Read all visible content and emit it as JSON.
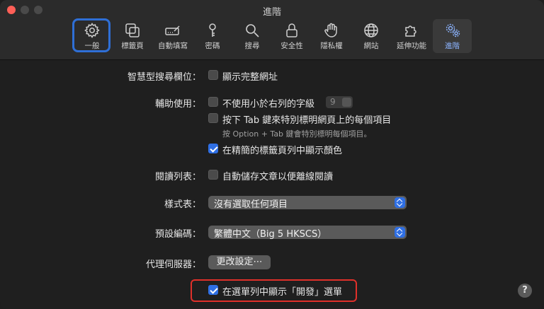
{
  "window": {
    "title": "進階"
  },
  "toolbar": {
    "items": [
      {
        "id": "general",
        "label": "一般",
        "icon": "gear-icon"
      },
      {
        "id": "tabs",
        "label": "標籤頁",
        "icon": "tabs-icon"
      },
      {
        "id": "autofill",
        "label": "自動填寫",
        "icon": "pencil-field-icon"
      },
      {
        "id": "passwords",
        "label": "密碼",
        "icon": "key-icon"
      },
      {
        "id": "search",
        "label": "搜尋",
        "icon": "search-icon"
      },
      {
        "id": "security",
        "label": "安全性",
        "icon": "lock-icon"
      },
      {
        "id": "privacy",
        "label": "隱私權",
        "icon": "hand-icon"
      },
      {
        "id": "websites",
        "label": "網站",
        "icon": "globe-icon"
      },
      {
        "id": "extensions",
        "label": "延伸功能",
        "icon": "puzzle-icon"
      },
      {
        "id": "advanced",
        "label": "進階",
        "icon": "gears-icon"
      }
    ]
  },
  "smart_search": {
    "label": "智慧型搜尋欄位：",
    "show_full_address": {
      "text": "顯示完整網址",
      "checked": false
    }
  },
  "accessibility": {
    "label": "輔助使用：",
    "min_font": {
      "text": "不使用小於右列的字級",
      "checked": false,
      "value": "9"
    },
    "tab_highlight": {
      "text": "按下 Tab 鍵來特別標明網頁上的每個項目",
      "checked": false
    },
    "hint": "按 Option + Tab 鍵會特別標明每個項目。",
    "color_compact": {
      "text": "在精簡的標籤頁列中顯示顏色",
      "checked": true
    }
  },
  "reading_list": {
    "label": "閱讀列表：",
    "auto_save": {
      "text": "自動儲存文章以便離線閱讀",
      "checked": false
    }
  },
  "style_sheet": {
    "label": "樣式表：",
    "value": "沒有選取任何項目"
  },
  "default_encoding": {
    "label": "預設編碼：",
    "value": "繁體中文（Big 5 HKSCS）"
  },
  "proxies": {
    "label": "代理伺服器：",
    "button": "更改設定⋯"
  },
  "develop_menu": {
    "text": "在選單列中顯示「開發」選單",
    "checked": true
  },
  "help": {
    "label": "?"
  }
}
